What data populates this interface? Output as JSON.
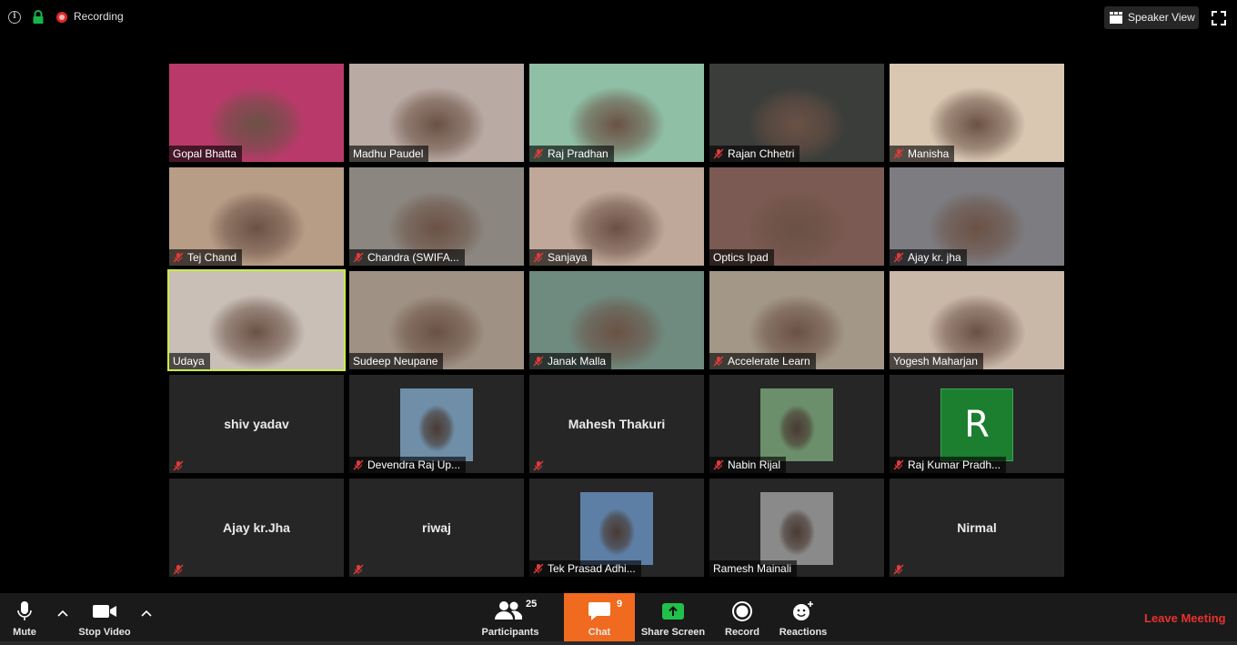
{
  "topbar": {
    "recording_label": "Recording",
    "speaker_view_label": "Speaker View"
  },
  "participants": [
    {
      "name": "Gopal Bhatta",
      "muted": false,
      "video": true,
      "bg": "#b93a6a"
    },
    {
      "name": "Madhu Paudel",
      "muted": false,
      "video": true,
      "bg": "#b9aaa3"
    },
    {
      "name": "Raj Pradhan",
      "muted": true,
      "video": true,
      "bg": "#8fbfa5"
    },
    {
      "name": "Rajan Chhetri",
      "muted": true,
      "video": true,
      "bg": "#3b3d3a"
    },
    {
      "name": "Manisha",
      "muted": true,
      "video": true,
      "bg": "#d9c7b2"
    },
    {
      "name": "Tej Chand",
      "muted": true,
      "video": true,
      "bg": "#b79c86"
    },
    {
      "name": "Chandra (SWIFA...",
      "muted": true,
      "video": true,
      "bg": "#8b8780"
    },
    {
      "name": "Sanjaya",
      "muted": true,
      "video": true,
      "bg": "#bfa89a"
    },
    {
      "name": "Optics Ipad",
      "muted": false,
      "video": true,
      "bg": "#7a5a52"
    },
    {
      "name": "Ajay kr. jha",
      "muted": true,
      "video": true,
      "bg": "#7d7c80"
    },
    {
      "name": "Udaya",
      "muted": false,
      "video": true,
      "bg": "#c9bfb7"
    },
    {
      "name": "Sudeep Neupane",
      "muted": false,
      "video": true,
      "bg": "#9f9285"
    },
    {
      "name": "Janak Malla",
      "muted": true,
      "video": true,
      "bg": "#6f8a7f"
    },
    {
      "name": "Accelerate Learn",
      "muted": true,
      "video": true,
      "bg": "#a39888"
    },
    {
      "name": "Yogesh Maharjan",
      "muted": false,
      "video": true,
      "bg": "#c9b7a8"
    },
    {
      "name": "shiv yadav",
      "muted": true,
      "video": false
    },
    {
      "name": "Devendra Raj Up...",
      "muted": true,
      "video": false,
      "thumb": "#6f8ea8"
    },
    {
      "name": "Mahesh Thakuri",
      "muted": true,
      "video": false
    },
    {
      "name": "Nabin Rijal",
      "muted": true,
      "video": false,
      "thumb": "#6b8f6a"
    },
    {
      "name": "Raj Kumar Pradh...",
      "muted": true,
      "video": false,
      "avatar_letter": "R"
    },
    {
      "name": "Ajay kr.Jha",
      "muted": true,
      "video": false
    },
    {
      "name": "riwaj",
      "muted": true,
      "video": false
    },
    {
      "name": "Tek Prasad Adhi...",
      "muted": true,
      "video": false,
      "thumb": "#5d7fa6"
    },
    {
      "name": "Ramesh Mainali",
      "muted": false,
      "video": false,
      "thumb": "#8a8a8a"
    },
    {
      "name": "Nirmal",
      "muted": true,
      "video": false
    }
  ],
  "toolbar": {
    "mute_label": "Mute",
    "stop_video_label": "Stop Video",
    "participants_label": "Participants",
    "participants_count": "25",
    "chat_label": "Chat",
    "chat_count": "9",
    "share_screen_label": "Share Screen",
    "record_label": "Record",
    "reactions_label": "Reactions",
    "leave_label": "Leave Meeting"
  }
}
